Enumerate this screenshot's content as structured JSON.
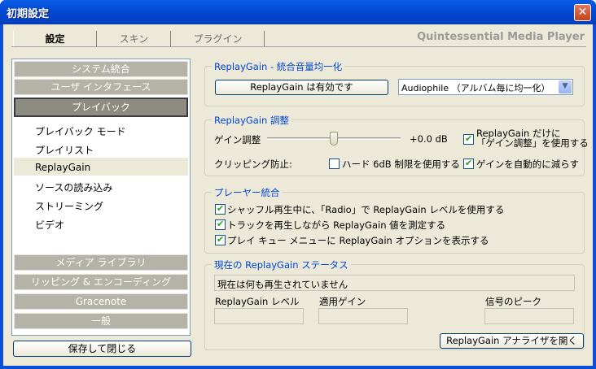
{
  "window": {
    "title": "初期設定",
    "close_glyph": "✕"
  },
  "tabs": [
    {
      "label": "設定",
      "active": true
    },
    {
      "label": "スキン",
      "active": false
    },
    {
      "label": "プラグイン",
      "active": false
    }
  ],
  "brand": "Quintessential Media Player",
  "nav": {
    "categories_top": [
      "システム統合",
      "ユーザ インタフェース",
      "プレイバック"
    ],
    "sub_items": [
      "プレイバック モード",
      "プレイリスト",
      "ReplayGain",
      "ソースの読み込み",
      "ストリーミング",
      "ビデオ"
    ],
    "categories_bottom": [
      "メディア ライブラリ",
      "リッピング & エンコーディング",
      "Gracenote",
      "一般"
    ],
    "selected_sub": "ReplayGain"
  },
  "save_button": "保存して閉じる",
  "unify": {
    "title": "ReplayGain - 統合音量均一化",
    "toggle_button": "ReplayGain は有効です",
    "mode_value": "Audiophile （アルバム毎に均一化）"
  },
  "adjust": {
    "title": "ReplayGain 調整",
    "gain_label": "ゲイン調整",
    "gain_value": "+0.0 dB",
    "gain_slider_fraction": 0.5,
    "only_gain": {
      "label_line1": "ReplayGain だけに",
      "label_line2": "「ゲイン調整」を使用する",
      "checked": true
    },
    "clip_label": "クリッピング防止:",
    "hard_limit": {
      "label": "ハード 6dB 制限を使用する",
      "checked": false
    },
    "auto_reduce": {
      "label": "ゲインを自動的に減らす",
      "checked": true
    }
  },
  "player": {
    "title": "プレーヤー統合",
    "options": [
      {
        "label": "シャッフル再生中に、「Radio」で ReplayGain レベルを使用する",
        "checked": true
      },
      {
        "label": "トラックを再生しながら ReplayGain 値を測定する",
        "checked": true
      },
      {
        "label": "プレイ キュー メニューに ReplayGain オプションを表示する",
        "checked": true
      }
    ]
  },
  "status": {
    "title": "現在の ReplayGain ステータス",
    "now_playing": "現在は何も再生されていません",
    "level_label": "ReplayGain レベル",
    "applied_label": "適用ゲイン",
    "peak_label": "信号のピーク",
    "analyzer_button": "ReplayGain アナライザを開く"
  },
  "colors": {
    "titlebar": "#0349d2",
    "group_title": "#0046d5",
    "category_bg": "#b5b2a8",
    "dialog_bg": "#ece9d8",
    "close_btn": "#c7421b"
  }
}
